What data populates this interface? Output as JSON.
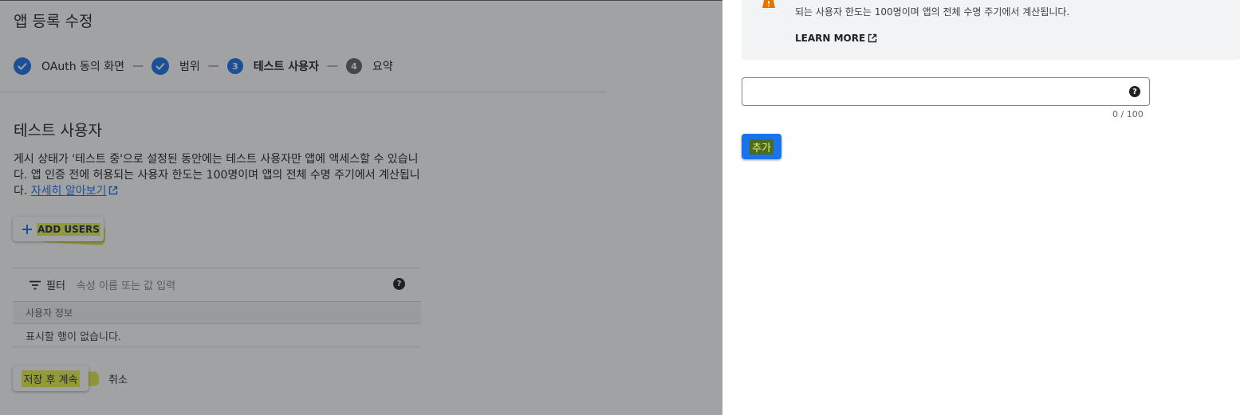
{
  "page": {
    "title": "앱 등록 수정"
  },
  "stepper": {
    "steps": [
      {
        "label": "OAuth 동의 화면",
        "state": "done"
      },
      {
        "label": "범위",
        "state": "done"
      },
      {
        "label": "테스트 사용자",
        "state": "active",
        "number": "3"
      },
      {
        "label": "요약",
        "state": "pending",
        "number": "4"
      }
    ],
    "separator": "—"
  },
  "section": {
    "title": "테스트 사용자",
    "description": "게시 상태가 '테스트 중'으로 설정된 동안에는 테스트 사용자만 앱에 액세스할 수 있습니다. 앱 인증 전에 허용되는 사용자 한도는 100명이며 앱의 전체 수명 주기에서 계산됩니다.",
    "learn_more_link": "자세히 알아보기",
    "add_users_label": "ADD USERS"
  },
  "filter": {
    "label": "필터",
    "placeholder": "속성 이름 또는 값 입력"
  },
  "table": {
    "header": "사용자 정보",
    "empty_text": "표시할 행이 없습니다."
  },
  "footer": {
    "save_label": "저장 후 계속",
    "cancel_label": "취소"
  },
  "panel": {
    "notice_text": "되는 사용자 한도는 100명이며 앱의 전체 수명 주기에서 계산됩니다.",
    "learn_more": "LEARN MORE",
    "email_value": "",
    "counter": "0 / 100",
    "add_label": "추가"
  },
  "colors": {
    "accent": "#1a73e8",
    "highlight": "#e9f04a",
    "warning": "#e37400"
  }
}
